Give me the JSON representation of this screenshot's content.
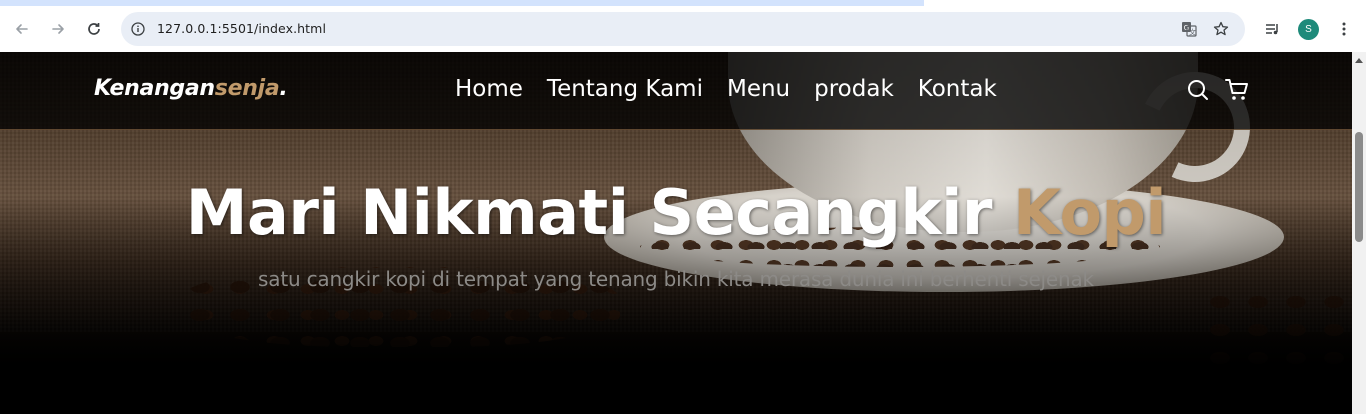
{
  "browser": {
    "url": "127.0.0.1:5501/index.html",
    "profile_initial": "S",
    "accent_color": "#1e8a7a",
    "icons": [
      "back-icon",
      "forward-icon",
      "reload-icon",
      "site-info-icon",
      "translate-icon",
      "star-icon",
      "media-control-icon",
      "menu-dots-icon"
    ]
  },
  "site": {
    "logo_main": "Kenangan",
    "logo_accent": "senja",
    "logo_dot": ".",
    "nav": [
      "Home",
      "Tentang Kami",
      "Menu",
      "prodak",
      "Kontak"
    ],
    "icons": [
      "search-icon",
      "cart-icon"
    ],
    "accent_color": "#c19a6b"
  },
  "hero": {
    "title_main": "Mari Nikmati Secangkir ",
    "title_accent": "Kopi",
    "subtitle": "satu cangkir kopi di tempat yang tenang bikin kita merasa dunia ini berhenti sejenak"
  }
}
